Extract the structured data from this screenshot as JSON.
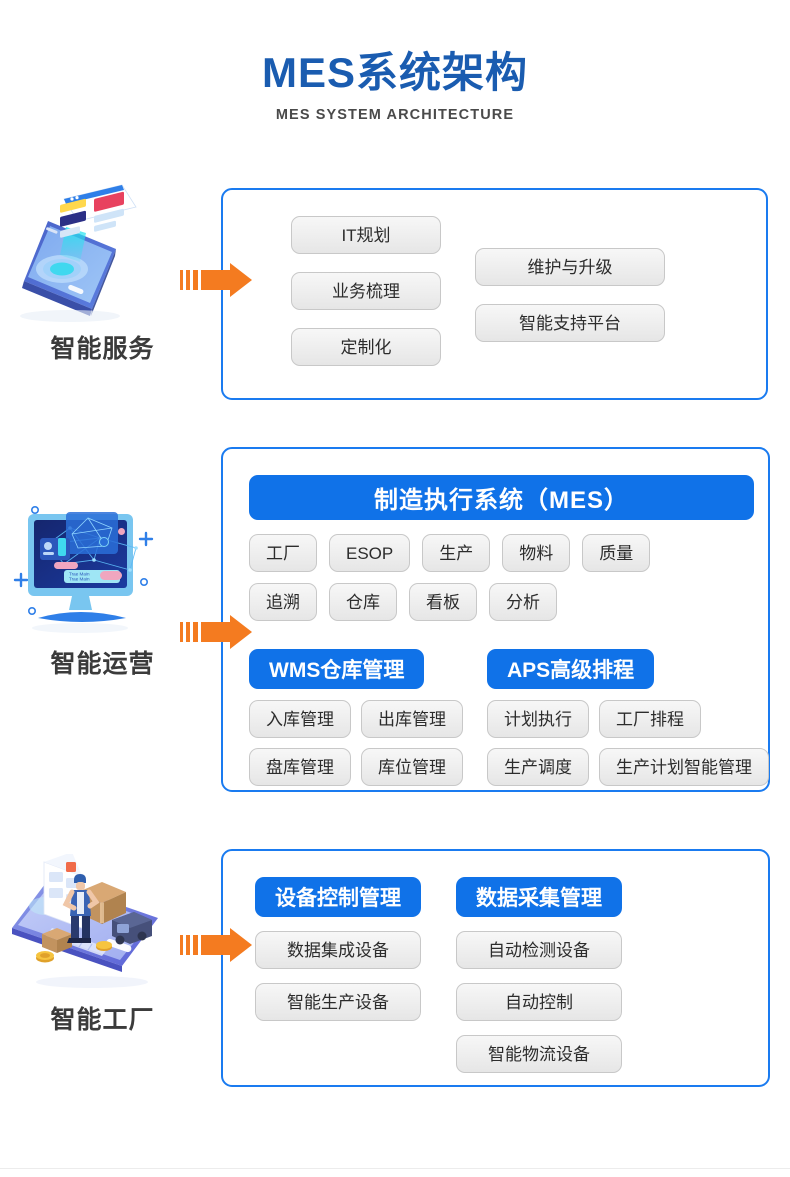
{
  "header": {
    "title_cn": "MES系统架构",
    "title_en": "MES SYSTEM ARCHITECTURE"
  },
  "colors": {
    "title_blue": "#1a5cb0",
    "panel_blue": "#1a7bf0",
    "bar_blue": "#1072e8",
    "arrow_orange": "#f47b20",
    "tag_gray": "#efefef",
    "tag_border": "#c8c8c8",
    "label_dark": "#3b3b3b"
  },
  "sections": [
    {
      "id": "smart-service",
      "label": "智能服务",
      "illustration": "smartphone-ui-cards-icon",
      "arrow": "orange-arrow-icon",
      "left_tags": [
        "IT规划",
        "业务梳理",
        "定制化"
      ],
      "right_tags": [
        "维护与升级",
        "智能支持平台"
      ]
    },
    {
      "id": "smart-operation",
      "label": "智能运营",
      "illustration": "desktop-monitor-network-icon",
      "arrow": "orange-arrow-icon",
      "main_bar": "制造执行系统（MES）",
      "core_rows": [
        [
          "工厂",
          "ESOP",
          "生产",
          "物料",
          "质量"
        ],
        [
          "追溯",
          "仓库",
          "看板",
          "分析"
        ]
      ],
      "sub_modules": [
        {
          "title": "WMS仓库管理",
          "rows": [
            [
              "入库管理",
              "出库管理"
            ],
            [
              "盘库管理",
              "库位管理"
            ]
          ]
        },
        {
          "title": "APS高级排程",
          "rows": [
            [
              "计划执行",
              "工厂排程"
            ],
            [
              "生产调度",
              "生产计划智能管理"
            ]
          ]
        }
      ]
    },
    {
      "id": "smart-factory",
      "label": "智能工厂",
      "illustration": "logistics-delivery-phone-icon",
      "arrow": "orange-arrow-icon",
      "columns": [
        {
          "title": "设备控制管理",
          "tags": [
            "数据集成设备",
            "智能生产设备"
          ]
        },
        {
          "title": "数据采集管理",
          "tags": [
            "自动检测设备",
            "自动控制",
            "智能物流设备"
          ]
        }
      ]
    }
  ]
}
